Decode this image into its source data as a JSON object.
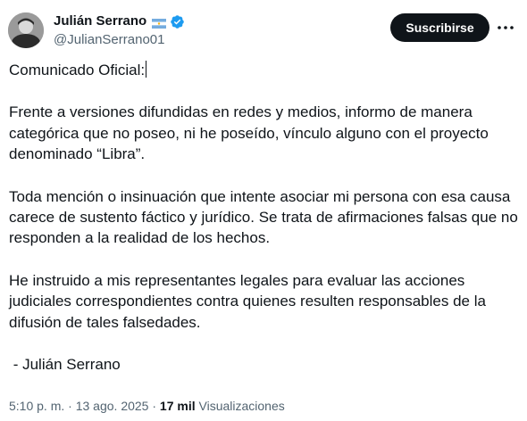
{
  "author": {
    "display_name": "Julián Serrano",
    "handle": "@JulianSerrano01",
    "flag_icon": "argentina-flag-icon",
    "verified_icon": "verified-badge-icon",
    "verified_color": "#1d9bf0"
  },
  "actions": {
    "subscribe_label": "Suscribirse",
    "more_icon": "more-options-icon"
  },
  "tweet": {
    "paragraphs": [
      "Comunicado Oficial:",
      "Frente a versiones difundidas en redes y medios, informo de manera categórica que no poseo, ni he poseído, vínculo alguno con el proyecto denominado “Libra”.",
      "Toda mención o insinuación que intente asociar mi persona con esa causa carece de sustento fáctico y jurídico. Se trata de afirmaciones falsas que no responden a la realidad de los hechos.",
      "He instruido a mis representantes legales para evaluar las acciones judiciales correspondientes contra quienes resulten responsables de la difusión de tales falsedades.",
      " - Julián Serrano"
    ]
  },
  "meta": {
    "time": "5:10 p. m.",
    "separator": " · ",
    "date": "13 ago. 2025",
    "views_count": "17 mil",
    "views_label": "Visualizaciones"
  }
}
